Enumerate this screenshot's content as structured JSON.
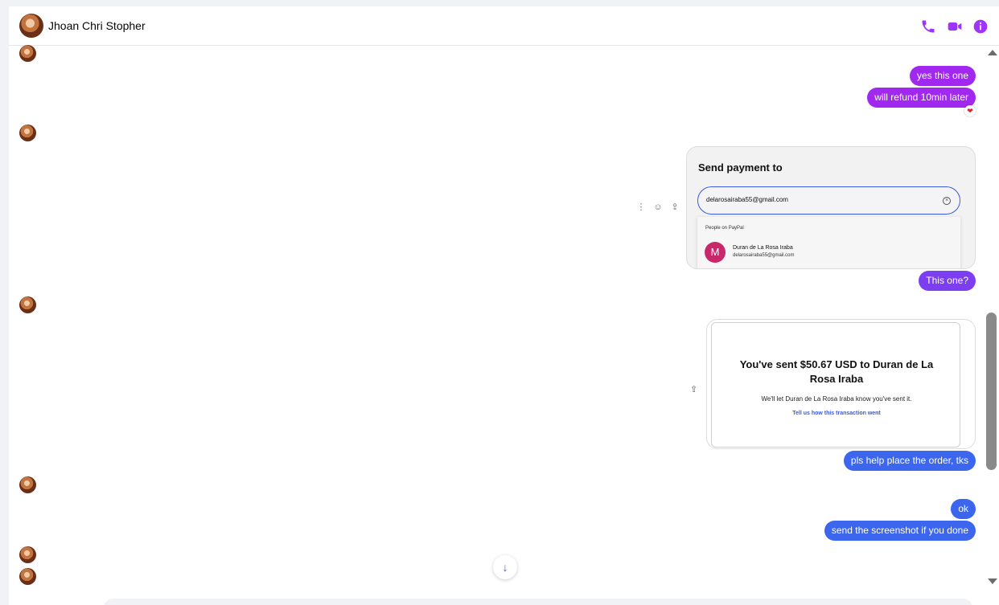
{
  "header": {
    "contact_name": "Jhoan Chri Stopher",
    "icons": [
      "phone-icon",
      "video-icon",
      "info-icon"
    ]
  },
  "messages": {
    "m1": "yes this one",
    "m2": "will refund 10min later",
    "m2_reaction": "❤",
    "m3": "This one?",
    "m4": "pls help place the order, tks",
    "m5": "ok",
    "m6": "send the screenshot if you done"
  },
  "payment_card": {
    "title": "Send payment to",
    "input_value": "delarosairaba55@gmail.com",
    "dropdown_label": "People on PayPal",
    "person_initial": "M",
    "person_name": "Duran de La Rosa Iraba",
    "person_email": "delarosairaba55@gmail.com"
  },
  "sent_card": {
    "title": "You've sent $50.67 USD to Duran de La Rosa Iraba",
    "subtitle": "We'll let Duran de La Rosa Iraba know you've sent it.",
    "link": "Tell us how this transaction went"
  },
  "colors": {
    "accent": "#a033ff",
    "bubble_purple": "#a028ef",
    "bubble_violet": "#7c3ef0",
    "bubble_blue": "#3d66ee"
  }
}
